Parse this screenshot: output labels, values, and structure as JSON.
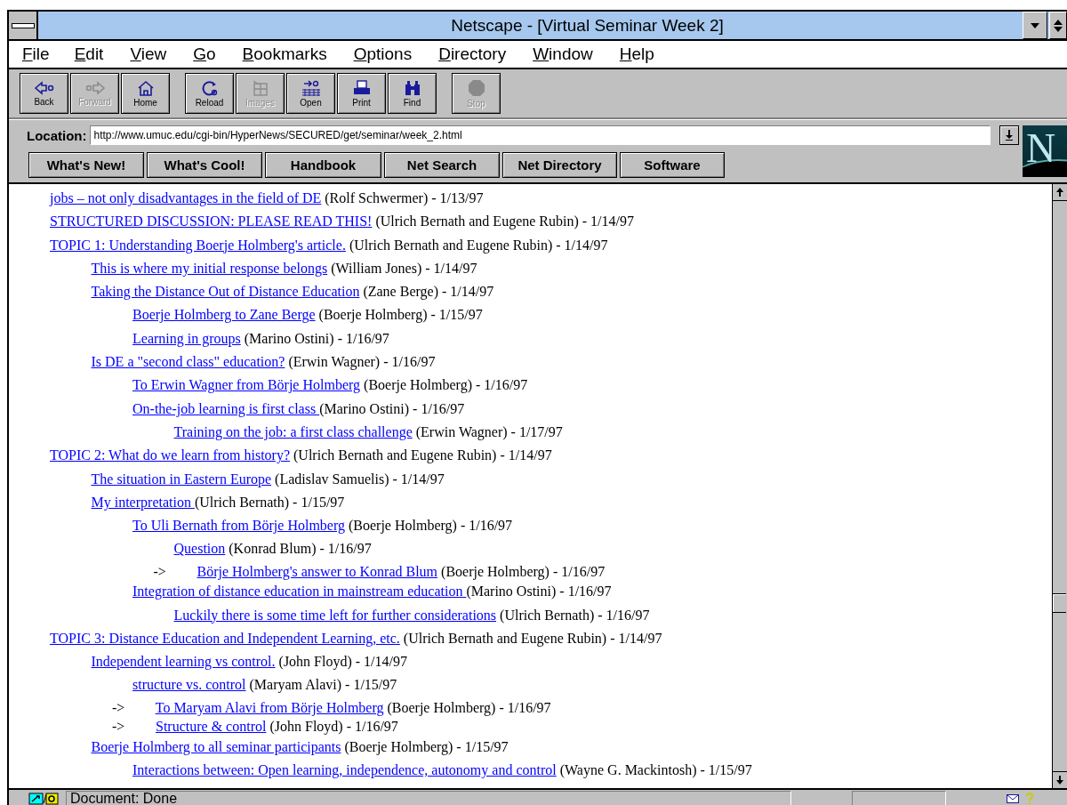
{
  "window": {
    "title": "Netscape - [Virtual Seminar Week 2]"
  },
  "menu": [
    "File",
    "Edit",
    "View",
    "Go",
    "Bookmarks",
    "Options",
    "Directory",
    "Window",
    "Help"
  ],
  "toolbar": [
    {
      "label": "Back",
      "kind": "back",
      "disabled": false
    },
    {
      "label": "Forward",
      "kind": "forward",
      "disabled": true
    },
    {
      "label": "Home",
      "kind": "home",
      "disabled": false
    },
    {
      "label": "Reload",
      "kind": "reload",
      "disabled": false
    },
    {
      "label": "Images",
      "kind": "images",
      "disabled": true
    },
    {
      "label": "Open",
      "kind": "open",
      "disabled": false
    },
    {
      "label": "Print",
      "kind": "print",
      "disabled": false
    },
    {
      "label": "Find",
      "kind": "find",
      "disabled": false
    },
    {
      "label": "Stop",
      "kind": "stop",
      "disabled": true
    }
  ],
  "location": {
    "label": "Location:",
    "value": "http://www.umuc.edu/cgi-bin/HyperNews/SECURED/get/seminar/week_2.html"
  },
  "logo": "N",
  "directory_buttons": [
    "What's New!",
    "What's Cool!",
    "Handbook",
    "Net Search",
    "Net Directory",
    "Software"
  ],
  "posts": [
    {
      "link": "jobs – not only disadvantages in the field of DE",
      "info": "(Rolf Schwermer) - 1/13/97"
    },
    {
      "link": "STRUCTURED DISCUSSION: PLEASE READ THIS!",
      "info": "(Ulrich Bernath and Eugene Rubin) - 1/14/97"
    },
    {
      "link": "TOPIC 1: Understanding Boerje Holmberg's article.",
      "info": "(Ulrich Bernath and Eugene Rubin) - 1/14/97",
      "children": [
        {
          "link": "This is where my initial response belongs",
          "info": "(William Jones) - 1/14/97"
        },
        {
          "link": "Taking the Distance Out of Distance Education",
          "info": "(Zane Berge) - 1/14/97",
          "children": [
            {
              "link": "Boerje Holmberg to Zane Berge",
              "info": "(Boerje Holmberg) - 1/15/97"
            },
            {
              "link": "Learning in groups",
              "info": "(Marino Ostini) - 1/16/97"
            }
          ]
        },
        {
          "link": "Is DE a \"second class\" education?",
          "info": "(Erwin Wagner) - 1/16/97",
          "children": [
            {
              "link": "To Erwin Wagner from Börje Holmberg",
              "info": "(Boerje Holmberg) - 1/16/97"
            },
            {
              "link": "On-the-job learning is first class ",
              "info": "(Marino Ostini) - 1/16/97",
              "children": [
                {
                  "link": "Training on the job: a first class challenge",
                  "info": "(Erwin Wagner) - 1/17/97"
                }
              ]
            }
          ]
        }
      ]
    },
    {
      "link": "TOPIC 2: What do we learn from history?",
      "info": "(Ulrich Bernath and Eugene Rubin) - 1/14/97",
      "children": [
        {
          "link": "The situation in Eastern Europe",
          "info": "(Ladislav Samuelis) - 1/14/97"
        },
        {
          "link": "My interpretation ",
          "info": "(Ulrich Bernath) - 1/15/97",
          "children": [
            {
              "link": "To Uli Bernath from Börje Holmberg",
              "info": "(Boerje Holmberg) - 1/16/97",
              "children": [
                {
                  "link": "Question",
                  "info": "(Konrad Blum) - 1/16/97"
                },
                {
                  "link": "Börje Holmberg's answer to Konrad Blum",
                  "info": "(Boerje Holmberg) - 1/16/97",
                  "prefix": "->"
                }
              ]
            },
            {
              "link": "Integration of distance education in mainstream education ",
              "info": "(Marino Ostini) - 1/16/97",
              "children": [
                {
                  "link": "Luckily there is some time left for further considerations",
                  "info": "(Ulrich Bernath) - 1/16/97"
                }
              ]
            }
          ]
        }
      ]
    },
    {
      "link": "TOPIC 3: Distance Education and Independent Learning, etc.",
      "info": "(Ulrich Bernath and Eugene Rubin) - 1/14/97",
      "children": [
        {
          "link": "Independent learning vs control.",
          "info": "(John Floyd) - 1/14/97",
          "children": [
            {
              "link": "structure vs. control",
              "info": "(Maryam Alavi) - 1/15/97"
            },
            {
              "link": "To Maryam Alavi from Börje Holmberg",
              "info": "(Boerje Holmberg) - 1/16/97",
              "prefix": "->"
            },
            {
              "link": "Structure & control",
              "info": "(John Floyd) - 1/16/97",
              "prefix": "->"
            }
          ]
        },
        {
          "link": "Boerje Holmberg to all seminar participants",
          "info": "(Boerje Holmberg) - 1/15/97",
          "children": [
            {
              "link": "Interactions between: Open learning, independence, autonomy and control",
              "info": "(Wayne G. Mackintosh) - 1/15/97"
            }
          ]
        }
      ]
    }
  ],
  "status_bar": {
    "text": "Document: Done"
  }
}
